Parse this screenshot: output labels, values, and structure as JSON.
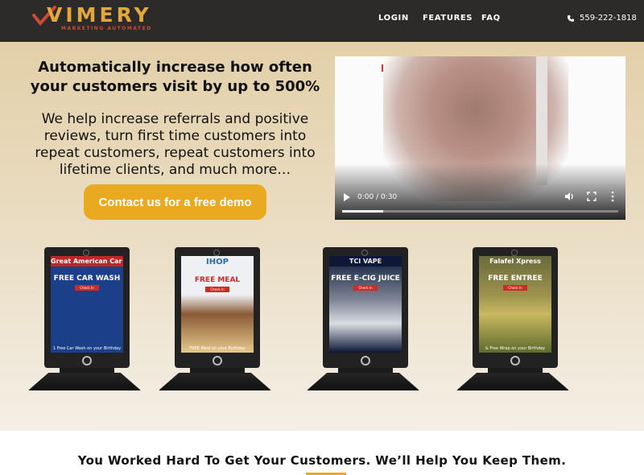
{
  "nav": {
    "logo_text": "VIMERY",
    "logo_tagline": "MARKETING AUTOMATED",
    "links": [
      "LOGIN",
      "FEATURES",
      "FAQ"
    ],
    "phone": "559-222-1818",
    "phone_icon": "phone-icon"
  },
  "hero": {
    "headline": "Automatically increase how often your customers visit by up to 500%",
    "subcopy": "We help increase referrals and positive reviews, turn first time customers into repeat customers, repeat customers into lifetime clients, and much more…",
    "cta_label": "Contact us for a free demo"
  },
  "video": {
    "time": "0:00 / 0:30",
    "progress": 0.15,
    "controls": [
      "play-icon",
      "volume-icon",
      "fullscreen-icon",
      "more-icon"
    ]
  },
  "kiosks": [
    {
      "brand": "Great American Car Wash",
      "offer": "FREE CAR WASH",
      "footer": "1 Free Car Wash on your Birthday"
    },
    {
      "brand": "IHOP",
      "offer": "FREE MEAL",
      "footer": "FREE Meal on your Birthday"
    },
    {
      "brand": "TCI VAPE",
      "offer": "FREE E-CIG JUICE",
      "footer": ""
    },
    {
      "brand": "Falafel Xpress",
      "offer": "FREE ENTREE",
      "footer": "& Free Wrap on your Birthday"
    }
  ],
  "tagline": "You Worked Hard To Get Your Customers. We’ll Help You Keep Them.",
  "colors": {
    "accent": "#e9aa22",
    "nav_bg": "#2c2b2a",
    "logo_check": "#c94a35"
  }
}
